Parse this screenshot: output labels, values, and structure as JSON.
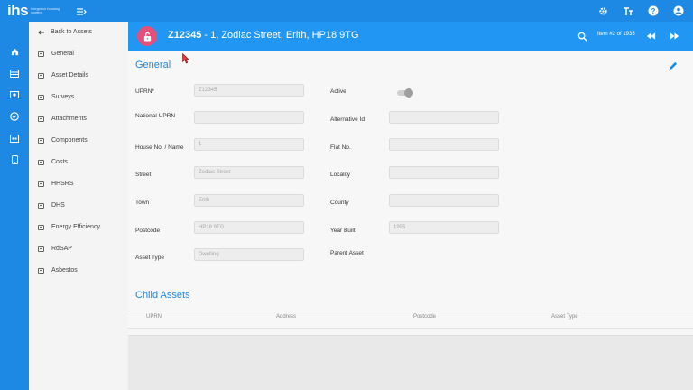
{
  "app": {
    "logo_text": "ihs",
    "logo_subtext": "Integrator housing system"
  },
  "colors": {
    "primary": "#1e88e5",
    "header": "#2196f3",
    "lock_badge": "#e5507a",
    "cursor": "#e53935"
  },
  "topbar": {
    "icons": [
      "settings-icon",
      "text-size-icon",
      "help-icon",
      "account-icon"
    ]
  },
  "rail": {
    "icons": [
      "home-icon",
      "assets-icon",
      "money-icon",
      "check-circle-icon",
      "calendar-icon",
      "mobile-icon"
    ]
  },
  "sidebar": {
    "back_label": "Back to Assets",
    "items": [
      {
        "label": "General"
      },
      {
        "label": "Asset Details"
      },
      {
        "label": "Surveys"
      },
      {
        "label": "Attachments"
      },
      {
        "label": "Components"
      },
      {
        "label": "Costs"
      },
      {
        "label": "HHSRS"
      },
      {
        "label": "DHS"
      },
      {
        "label": "Energy Efficiency"
      },
      {
        "label": "RdSAP"
      },
      {
        "label": "Asbestos"
      }
    ]
  },
  "asset_header": {
    "asset_id": "Z12345",
    "address": " - 1, Zodiac Street, Erith, HP18 9TG",
    "item_count": "Item #2 of 1935"
  },
  "general": {
    "title": "General",
    "fields": {
      "uprn": {
        "label": "UPRN*",
        "value": "Z12345"
      },
      "national_uprn": {
        "label": "National UPRN",
        "value": ""
      },
      "house_no": {
        "label": "House No. / Name",
        "value": "1"
      },
      "street": {
        "label": "Street",
        "value": "Zodiac Street"
      },
      "town": {
        "label": "Town",
        "value": "Erith"
      },
      "postcode": {
        "label": "Postcode",
        "value": "HP18 9TG"
      },
      "asset_type": {
        "label": "Asset Type",
        "value": "Dwelling"
      },
      "active": {
        "label": "Active"
      },
      "alternative_id": {
        "label": "Alternative Id",
        "value": ""
      },
      "flat_no": {
        "label": "Flat No.",
        "value": ""
      },
      "locality": {
        "label": "Locality",
        "value": ""
      },
      "county": {
        "label": "County",
        "value": ""
      },
      "year_built": {
        "label": "Year Built",
        "value": "1995"
      },
      "parent_asset": {
        "label": "Parent Asset"
      }
    }
  },
  "child_assets": {
    "title": "Child Assets",
    "columns": [
      "UPRN",
      "Address",
      "Postcode",
      "Asset Type"
    ]
  }
}
